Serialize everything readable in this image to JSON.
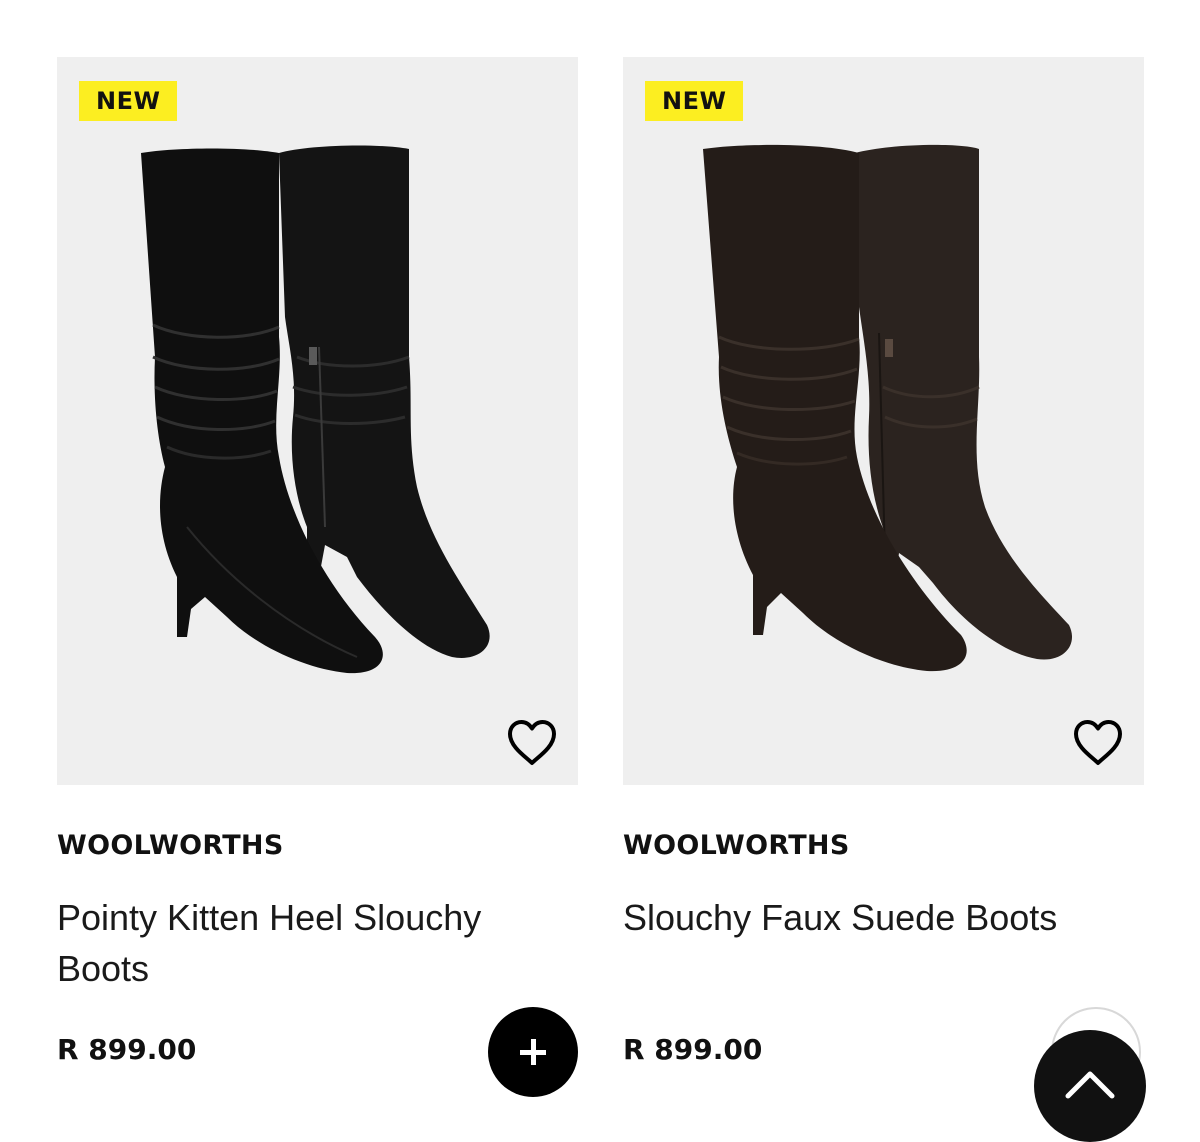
{
  "products": [
    {
      "badge": "NEW",
      "brand": "WOOLWORTHS",
      "name": "Pointy Kitten Heel Slouchy Boots",
      "price": "R 899.00",
      "image_icon": "black-leather-boots-image",
      "wishlist_icon": "heart-outline-icon",
      "add_icon": "plus-icon"
    },
    {
      "badge": "NEW",
      "brand": "WOOLWORTHS",
      "name": "Slouchy Faux Suede Boots",
      "price": "R 899.00",
      "image_icon": "brown-suede-boots-image",
      "wishlist_icon": "heart-outline-icon"
    }
  ],
  "scroll_top_icon": "chevron-up-icon",
  "colors": {
    "badge_bg": "#fcee21",
    "card_bg": "#efefef",
    "black_boot": "#1a1a1a",
    "brown_boot": "#2e241f",
    "button_bg": "#000000"
  }
}
